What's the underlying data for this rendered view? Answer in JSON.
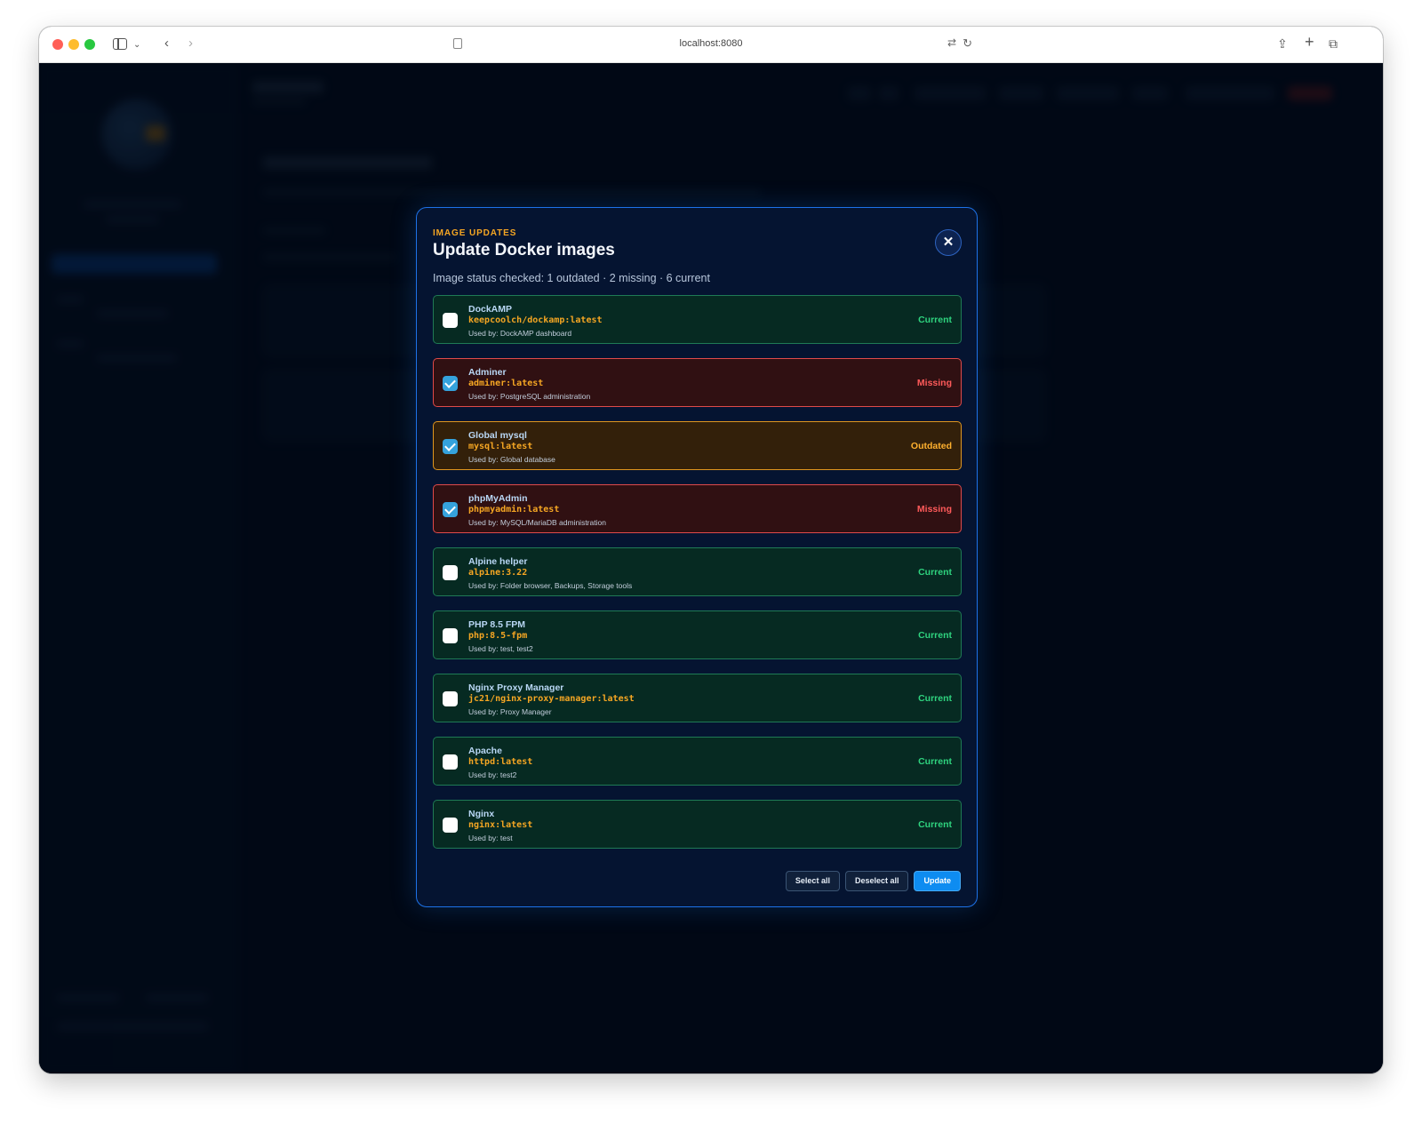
{
  "browser": {
    "url": "localhost:8080"
  },
  "modal": {
    "eyebrow": "IMAGE UPDATES",
    "title": "Update Docker images",
    "summary": "Image status checked: 1 outdated · 2 missing · 6 current",
    "close_label": "✕",
    "images": [
      {
        "name": "DockAMP",
        "tag": "keepcoolch/dockamp:latest",
        "used_by": "Used by: DockAMP dashboard",
        "status": "Current",
        "checked": false
      },
      {
        "name": "Adminer",
        "tag": "adminer:latest",
        "used_by": "Used by: PostgreSQL administration",
        "status": "Missing",
        "checked": true
      },
      {
        "name": "Global mysql",
        "tag": "mysql:latest",
        "used_by": "Used by: Global database",
        "status": "Outdated",
        "checked": true
      },
      {
        "name": "phpMyAdmin",
        "tag": "phpmyadmin:latest",
        "used_by": "Used by: MySQL/MariaDB administration",
        "status": "Missing",
        "checked": true
      },
      {
        "name": "Alpine helper",
        "tag": "alpine:3.22",
        "used_by": "Used by: Folder browser, Backups, Storage tools",
        "status": "Current",
        "checked": false
      },
      {
        "name": "PHP 8.5 FPM",
        "tag": "php:8.5-fpm",
        "used_by": "Used by: test, test2",
        "status": "Current",
        "checked": false
      },
      {
        "name": "Nginx Proxy Manager",
        "tag": "jc21/nginx-proxy-manager:latest",
        "used_by": "Used by: Proxy Manager",
        "status": "Current",
        "checked": false
      },
      {
        "name": "Apache",
        "tag": "httpd:latest",
        "used_by": "Used by: test2",
        "status": "Current",
        "checked": false
      },
      {
        "name": "Nginx",
        "tag": "nginx:latest",
        "used_by": "Used by: test",
        "status": "Current",
        "checked": false
      }
    ],
    "buttons": {
      "select_all": "Select all",
      "deselect_all": "Deselect all",
      "update": "Update"
    }
  },
  "colors": {
    "accent": "#1d72e8",
    "eyebrow": "#f5a623",
    "status_current": "#2fd47f",
    "status_missing": "#ff5a5a",
    "status_outdated": "#ffb02e"
  }
}
